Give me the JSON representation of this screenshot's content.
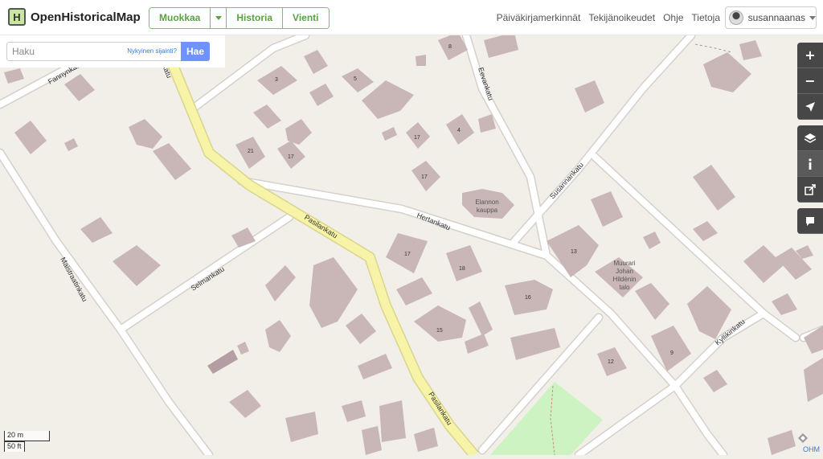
{
  "header": {
    "app_name": "OpenHistoricalMap",
    "edit_label": "Muokkaa",
    "history_label": "Historia",
    "export_label": "Vienti",
    "nav": [
      "Päiväkirjamerkinnät",
      "Tekijänoikeudet",
      "Ohje",
      "Tietoja"
    ],
    "user_name": "susannaanas"
  },
  "search": {
    "placeholder": "Haku",
    "where_am_i": "Nykyinen sijainti?",
    "go_label": "Hae"
  },
  "map": {
    "streets": [
      "Fannynkatu",
      "Pasilankatu",
      "Eevankatu",
      "Hertankatu",
      "Susannankatu",
      "Selmankatu",
      "Maistraatinkatu",
      "Kyllikinkatu"
    ],
    "house_numbers": [
      "3",
      "5",
      "8",
      "4",
      "21",
      "17",
      "17",
      "17",
      "17",
      "18",
      "13",
      "16",
      "15",
      "9",
      "12"
    ],
    "poi_labels": [
      "Elannon kauppa",
      "Muurari Johan Hildénin talo"
    ],
    "colors": {
      "land": "#f2efe9",
      "building": "#c9b7b8",
      "building_dark": "#b49ea3",
      "road": "#ffffff",
      "road_casing": "#d4d1cc",
      "main_road": "#f7f3a7",
      "main_road_casing": "#d9d58f",
      "park": "#cdf3c3"
    }
  },
  "controls": {
    "zoom_in": "+",
    "zoom_out": "−"
  },
  "scale": {
    "metric": "20 m",
    "imperial": "50 ft"
  },
  "attribution": "OHM"
}
